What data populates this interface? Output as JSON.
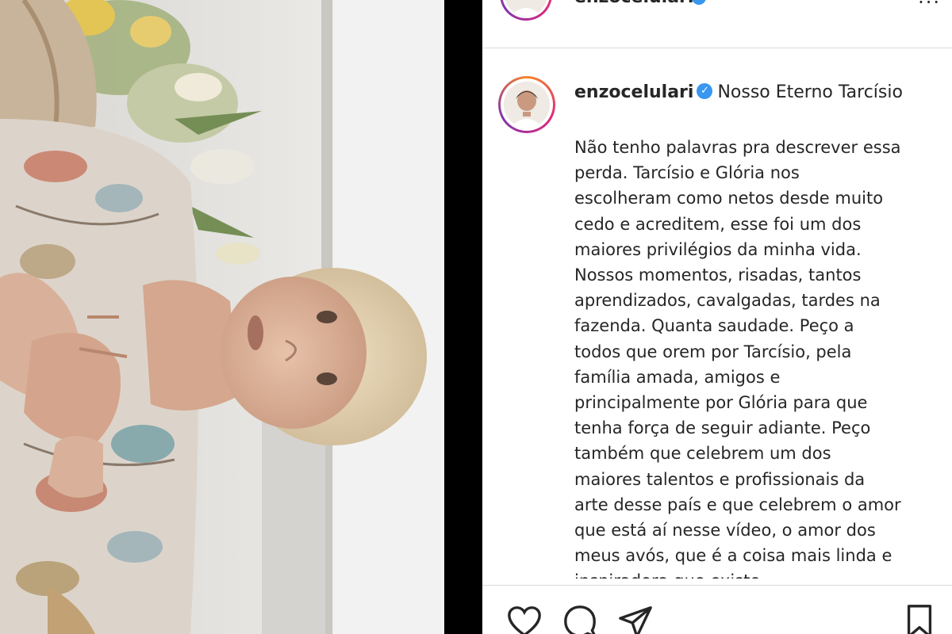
{
  "top_header": {
    "username": "enzocelulari",
    "more": "..."
  },
  "post": {
    "username": "enzocelulari",
    "title": "Nosso Eterno Tarcísio",
    "caption_lines": [
      "Não tenho palavras pra descrever essa",
      "perda. Tarcísio e Glória nos",
      "escolheram como netos desde muito",
      "cedo e acreditem, esse foi um dos",
      "maiores privilégios da minha vida.",
      "Nossos momentos, risadas, tantos",
      "aprendizados, cavalgadas, tardes na",
      "fazenda. Quanta saudade. Peço a",
      "todos que orem por Tarcísio, pela",
      "família amada, amigos e",
      "principalmente por Glória para que",
      "tenha força de seguir adiante. Peço",
      "também que celebrem um dos",
      "maiores talentos e profissionais da",
      "arte desse país e que celebrem o amor",
      "que está aí nesse vídeo, o amor dos",
      "meus avós, que é a coisa mais linda e",
      "inspiradora que existe"
    ]
  },
  "actions": {
    "like": "heart-icon",
    "comment": "comment-icon",
    "share": "paper-plane-icon",
    "save": "bookmark-icon"
  },
  "colors": {
    "verified": "#3897f0",
    "text": "#262626",
    "border": "#dbdbdb"
  }
}
